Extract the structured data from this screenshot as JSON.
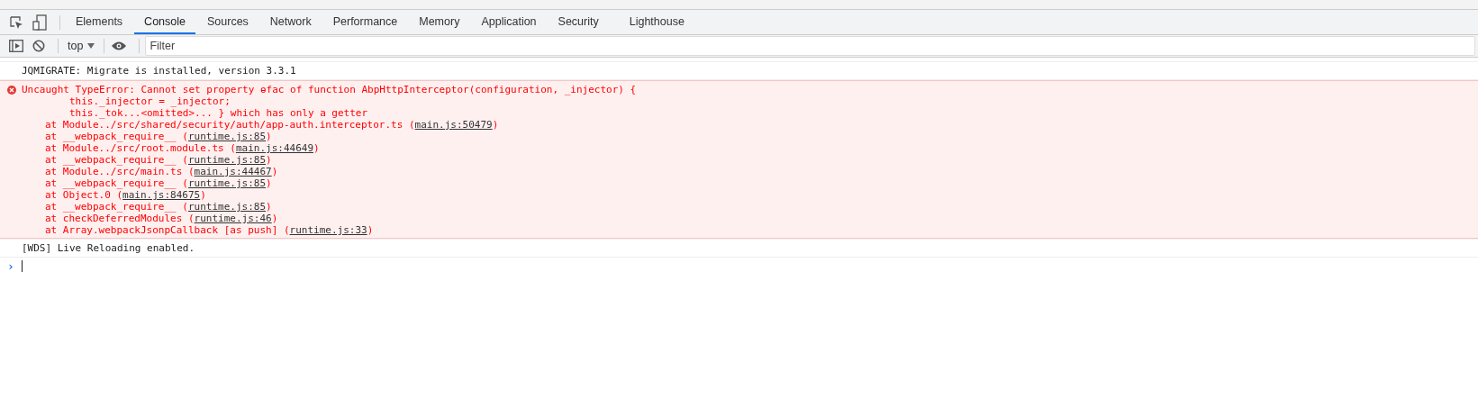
{
  "tabs": [
    {
      "label": "Elements",
      "selected": false
    },
    {
      "label": "Console",
      "selected": true
    },
    {
      "label": "Sources",
      "selected": false
    },
    {
      "label": "Network",
      "selected": false
    },
    {
      "label": "Performance",
      "selected": false
    },
    {
      "label": "Memory",
      "selected": false
    },
    {
      "label": "Application",
      "selected": false
    },
    {
      "label": "Security",
      "selected": false
    },
    {
      "label": "Lighthouse",
      "selected": false
    }
  ],
  "toolbar": {
    "context": "top",
    "filter": {
      "placeholder": "Filter"
    }
  },
  "messages": [
    {
      "kind": "log",
      "text": "JQMIGRATE: Migrate is installed, version 3.3.1"
    },
    {
      "kind": "error",
      "lines": [
        "Uncaught TypeError: Cannot set property ɵfac of function AbpHttpInterceptor(configuration, _injector) {",
        "        this._injector = _injector;",
        "        this._tok...<omitted>... } which has only a getter"
      ],
      "stack": [
        {
          "text": "at Module../src/shared/security/auth/app-auth.interceptor.ts (",
          "link": "main.js:50479",
          "end": ")"
        },
        {
          "text": "at __webpack_require__ (",
          "link": "runtime.js:85",
          "end": ")"
        },
        {
          "text": "at Module../src/root.module.ts (",
          "link": "main.js:44649",
          "end": ")"
        },
        {
          "text": "at __webpack_require__ (",
          "link": "runtime.js:85",
          "end": ")"
        },
        {
          "text": "at Module../src/main.ts (",
          "link": "main.js:44467",
          "end": ")"
        },
        {
          "text": "at __webpack_require__ (",
          "link": "runtime.js:85",
          "end": ")"
        },
        {
          "text": "at Object.0 (",
          "link": "main.js:84675",
          "end": ")"
        },
        {
          "text": "at __webpack_require__ (",
          "link": "runtime.js:85",
          "end": ")"
        },
        {
          "text": "at checkDeferredModules (",
          "link": "runtime.js:46",
          "end": ")"
        },
        {
          "text": "at Array.webpackJsonpCallback [as push] (",
          "link": "runtime.js:33",
          "end": ")"
        }
      ]
    },
    {
      "kind": "log",
      "text": "[WDS] Live Reloading enabled."
    }
  ],
  "prompt": {
    "symbol": "›"
  }
}
